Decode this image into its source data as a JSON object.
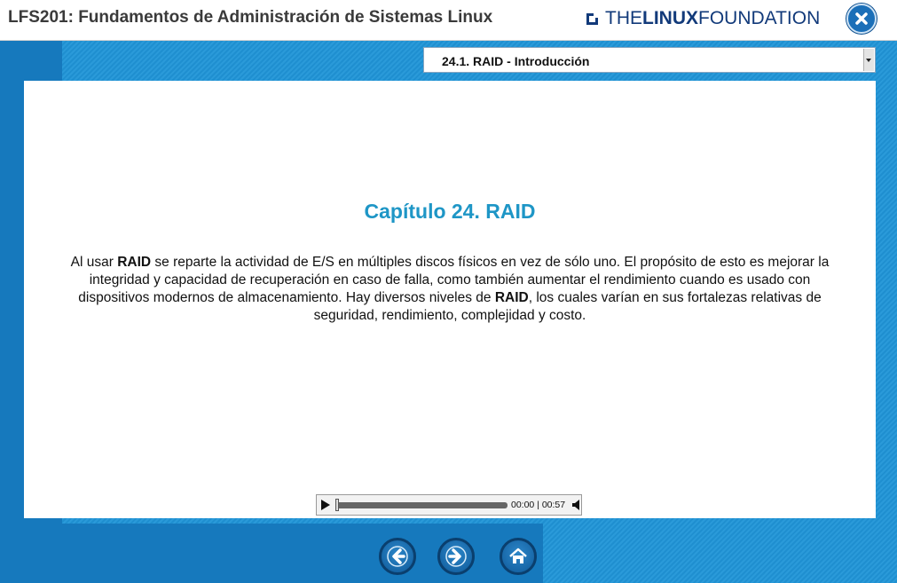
{
  "header": {
    "title": "LFS201: Fundamentos de Administración de Sistemas Linux",
    "logo": {
      "the": "THE",
      "linux": "LINUX",
      "foundation": "FOUNDATION"
    },
    "close_icon": "close-icon"
  },
  "nav": {
    "selected_section": "24.1. RAID - Introducción"
  },
  "content": {
    "chapter_title": "Capítulo 24. RAID",
    "paragraph": {
      "p1": "Al usar ",
      "b1": "RAID",
      "p2": " se reparte la actividad de E/S en múltiples discos físicos en vez de sólo uno. El propósito de esto es mejorar la integridad y capacidad de recuperación en caso de falla, como también aumentar el rendimiento cuando es usado con dispositivos modernos de almacenamiento. Hay diversos niveles de ",
      "b2": "RAID",
      "p3": ", los cuales varían en sus fortalezas relativas de seguridad, rendimiento, complejidad y costo."
    }
  },
  "player": {
    "time": "00:00 | 00:57",
    "progress": 0,
    "play_icon": "play-icon",
    "volume_icon": "volume-icon"
  },
  "footer": {
    "buttons": [
      "back-arrow-icon",
      "forward-arrow-icon",
      "home-icon"
    ]
  },
  "colors": {
    "accent": "#1e96c6",
    "background_blue": "#1a88c8",
    "logo_blue": "#123a7a"
  }
}
